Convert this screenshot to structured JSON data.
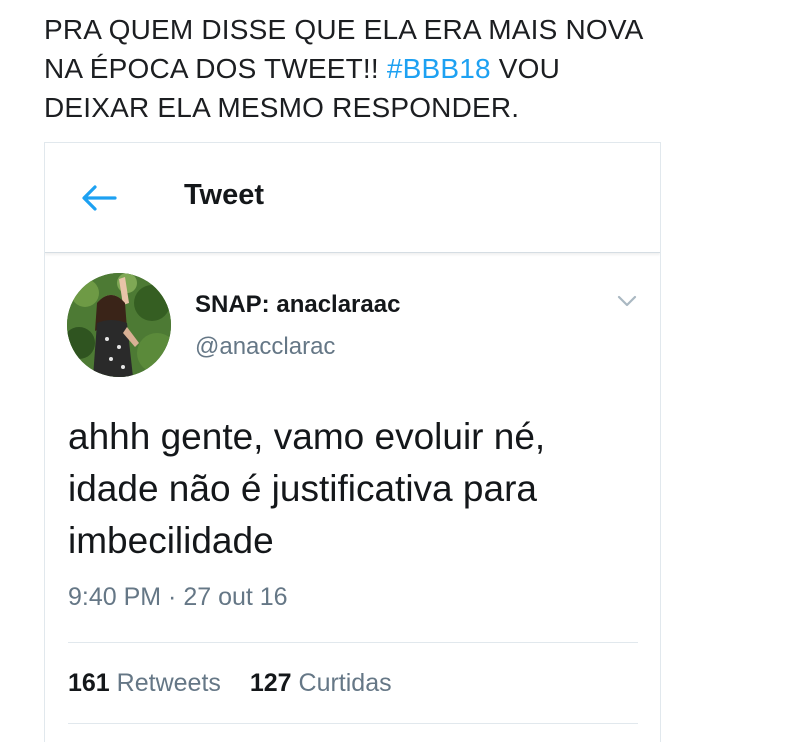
{
  "caption": {
    "line1": "PRA QUEM DISSE QUE ELA ERA MAIS NOVA",
    "line2_before": "NA ÉPOCA DOS TWEET!! ",
    "hashtag": "#BBB18",
    "line2_after": " VOU",
    "line3": "DEIXAR ELA MESMO RESPONDER."
  },
  "header": {
    "back_icon": "arrow-left-icon",
    "title": "Tweet"
  },
  "tweet": {
    "display_name": "SNAP: anaclaraac",
    "handle": "@anacclarac",
    "text_lines": [
      "ahhh gente, vamo evoluir né,",
      "idade não é justificativa para",
      "imbecilidade"
    ],
    "timestamp": "9:40 PM · 27 out 16",
    "retweets_count": "161",
    "retweets_label": "Retweets",
    "likes_count": "127",
    "likes_label": "Curtidas"
  },
  "colors": {
    "accent": "#1da1f2",
    "text": "#14171a",
    "muted": "#657786",
    "border": "#e1e8ed"
  }
}
